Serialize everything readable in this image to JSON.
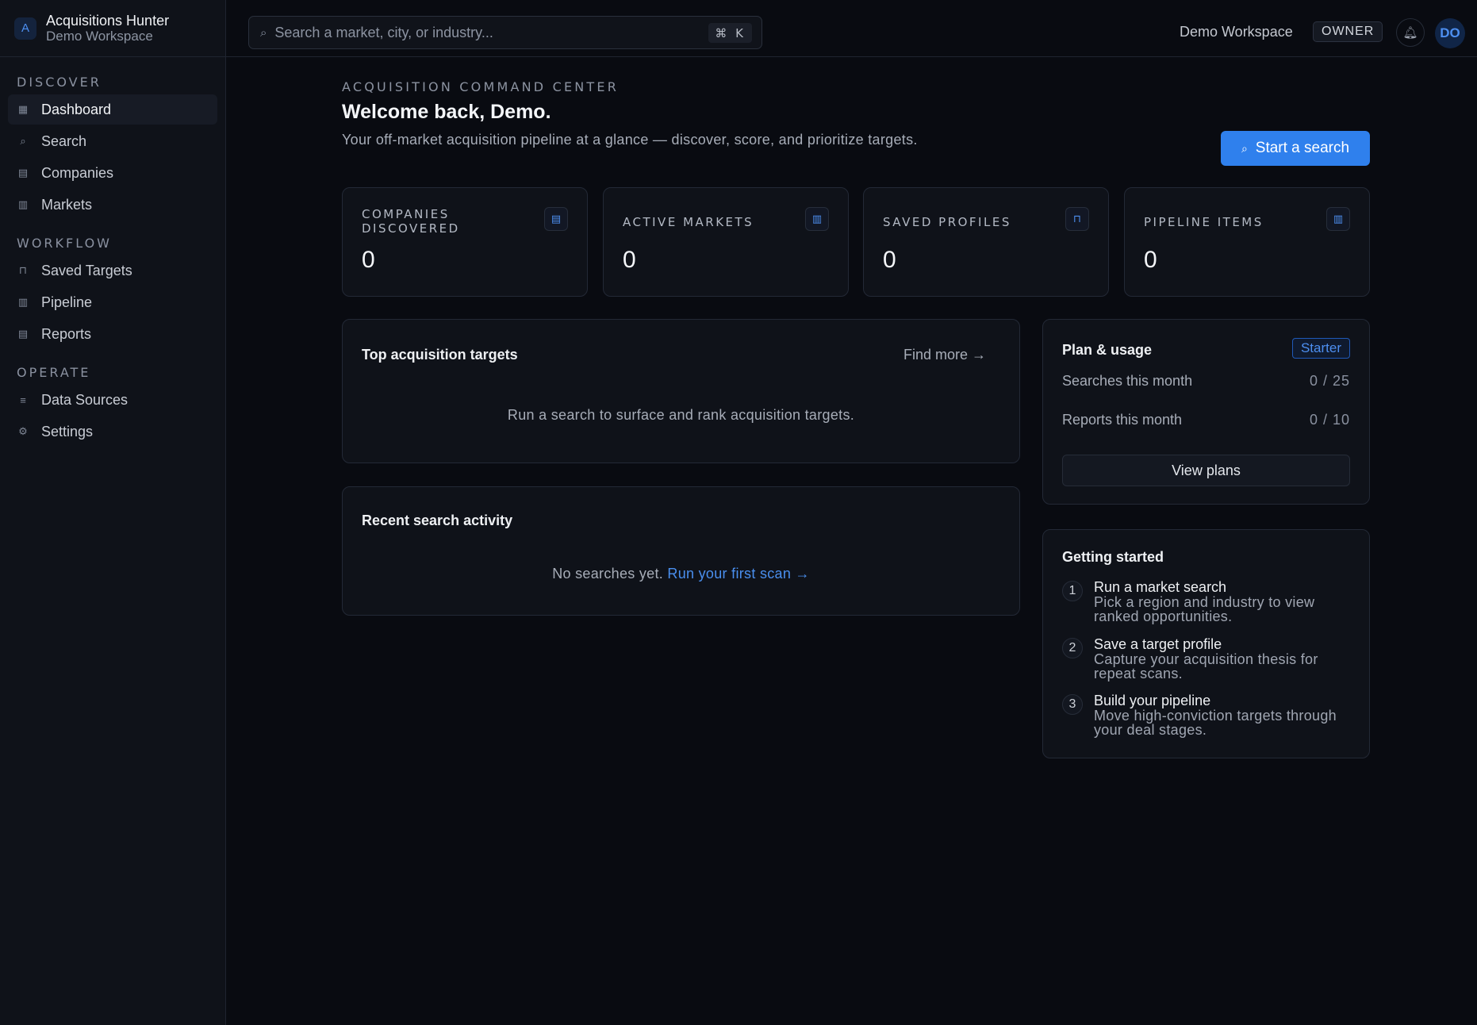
{
  "brand": {
    "logo": "A",
    "name": "Acquisitions Hunter",
    "workspace": "Demo Workspace"
  },
  "sidebar": {
    "sections": [
      {
        "title": "DISCOVER",
        "items": [
          {
            "label": "Dashboard",
            "icon": "dashboard-icon",
            "glyph": "▦",
            "active": true
          },
          {
            "label": "Search",
            "icon": "search-icon",
            "glyph": "⌕"
          },
          {
            "label": "Companies",
            "icon": "building-icon",
            "glyph": "▤"
          },
          {
            "label": "Markets",
            "icon": "map-icon",
            "glyph": "▥"
          }
        ]
      },
      {
        "title": "WORKFLOW",
        "items": [
          {
            "label": "Saved Targets",
            "icon": "bookmark-icon",
            "glyph": "⊓"
          },
          {
            "label": "Pipeline",
            "icon": "kanban-icon",
            "glyph": "▥"
          },
          {
            "label": "Reports",
            "icon": "document-icon",
            "glyph": "▤"
          }
        ]
      },
      {
        "title": "OPERATE",
        "items": [
          {
            "label": "Data Sources",
            "icon": "database-icon",
            "glyph": "≡"
          },
          {
            "label": "Settings",
            "icon": "gear-icon",
            "glyph": "⚙"
          }
        ]
      }
    ]
  },
  "topbar": {
    "search_placeholder": "Search a market, city, or industry...",
    "shortcut": "⌘ K",
    "workspace": "Demo Workspace",
    "role": "OWNER",
    "avatar": "DO"
  },
  "header": {
    "eyebrow": "ACQUISITION COMMAND CENTER",
    "title": "Welcome back, Demo.",
    "description": "Your off-market acquisition pipeline at a glance — discover, score, and prioritize targets.",
    "cta": "Start a search"
  },
  "stats": [
    {
      "label": "COMPANIES DISCOVERED",
      "value": "0",
      "icon": "building-icon",
      "glyph": "▤"
    },
    {
      "label": "ACTIVE MARKETS",
      "value": "0",
      "icon": "map-icon",
      "glyph": "▥"
    },
    {
      "label": "SAVED PROFILES",
      "value": "0",
      "icon": "bookmark-icon",
      "glyph": "⊓"
    },
    {
      "label": "PIPELINE ITEMS",
      "value": "0",
      "icon": "kanban-icon",
      "glyph": "▥"
    }
  ],
  "top_targets": {
    "title": "Top acquisition targets",
    "link": "Find more →",
    "empty": "Run a search to surface and rank acquisition targets."
  },
  "recent_activity": {
    "title": "Recent search activity",
    "empty": "No searches yet.",
    "empty_link": "Run your first scan →"
  },
  "plan": {
    "title": "Plan & usage",
    "tier": "Starter",
    "rows": [
      {
        "label": "Searches this month",
        "value": "0 / 25"
      },
      {
        "label": "Reports this month",
        "value": "0 / 10"
      }
    ],
    "button": "View plans"
  },
  "getting_started": {
    "title": "Getting started",
    "steps": [
      {
        "num": "1",
        "title": "Run a market search",
        "desc": "Pick a region and industry to view ranked opportunities."
      },
      {
        "num": "2",
        "title": "Save a target profile",
        "desc": "Capture your acquisition thesis for repeat scans."
      },
      {
        "num": "3",
        "title": "Build your pipeline",
        "desc": "Move high-conviction targets through your deal stages."
      }
    ]
  },
  "colors": {
    "accent": "#2f80ed",
    "background": "#090b11",
    "surface": "#0f1219"
  }
}
